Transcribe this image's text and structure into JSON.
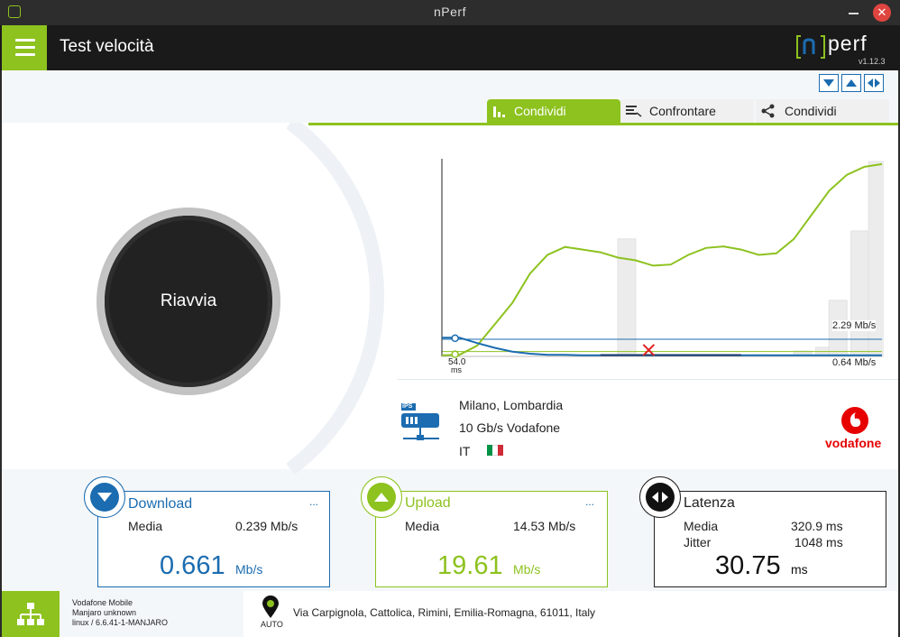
{
  "window": {
    "title": "nPerf"
  },
  "header": {
    "title": "Test velocità",
    "logo_text": "perf",
    "version": "v1.12.3"
  },
  "tabs": [
    {
      "label": "Condividi",
      "active": true,
      "icon": "bar-chart-icon"
    },
    {
      "label": "Confrontare",
      "active": false,
      "icon": "compare-icon"
    },
    {
      "label": "Condividi",
      "active": false,
      "icon": "share-icon"
    }
  ],
  "restart_button": {
    "label": "Riavvia"
  },
  "chart_data": {
    "type": "line",
    "x": [
      0,
      4,
      8,
      12,
      16,
      20,
      24,
      28,
      32,
      36,
      40,
      44,
      48,
      52,
      56,
      60,
      64,
      68,
      72,
      76,
      80,
      84,
      88,
      92,
      96,
      100
    ],
    "series": [
      {
        "color": "#8dc21f",
        "values": [
          0.2,
          0.3,
          2.0,
          6.0,
          10.0,
          15.5,
          19.0,
          20.5,
          20.0,
          19.5,
          18.5,
          18.0,
          17.0,
          17.2,
          19.0,
          20.3,
          20.6,
          20.0,
          19.0,
          19.3,
          22.0,
          26.5,
          31.0,
          34.0,
          35.5,
          36.0
        ]
      },
      {
        "color": "#1b6cb0",
        "values": [
          3.5,
          3.5,
          2.5,
          1.6,
          0.9,
          0.5,
          0.3,
          0.3,
          0.2,
          0.2,
          0.2,
          0.2,
          0.2,
          0.2,
          0.2,
          0.2,
          0.2,
          0.2,
          0.2,
          0.2,
          0.2,
          0.2,
          0.2,
          0.2,
          0.2,
          0.2
        ]
      }
    ],
    "bars": [
      {
        "x": 42,
        "value": 22
      },
      {
        "x": 72,
        "value": 0.3
      },
      {
        "x": 82,
        "value": 1.0
      },
      {
        "x": 87,
        "value": 1.7
      },
      {
        "x": 90,
        "value": 10.5
      },
      {
        "x": 95,
        "value": 23.5
      },
      {
        "x": 99,
        "value": 36.5
      }
    ],
    "ylim": [
      0,
      37
    ],
    "xlim": [
      0,
      100
    ],
    "labels": {
      "upload_avg": "2.29 Mb/s",
      "download_avg": "0.64 Mb/s",
      "latency_start": "54.0",
      "latency_unit": "ms"
    }
  },
  "server": {
    "location": "Milano, Lombardia",
    "capacity": "10 Gb/s Vodafone",
    "country": "IT",
    "ips_label": "IPS",
    "isp_name": "vodafone"
  },
  "download": {
    "title": "Download",
    "more": "...",
    "avg_label": "Media",
    "avg_value": "0.239 Mb/s",
    "value": "0.661",
    "unit": "Mb/s"
  },
  "upload": {
    "title": "Upload",
    "more": "...",
    "avg_label": "Media",
    "avg_value": "14.53 Mb/s",
    "value": "19.61",
    "unit": "Mb/s"
  },
  "latency": {
    "title": "Latenza",
    "avg_label": "Media",
    "avg_value": "320.9 ms",
    "jitter_label": "Jitter",
    "jitter_value": "1048 ms",
    "value": "30.75",
    "unit": "ms"
  },
  "footer": {
    "network_line1": "Vodafone Mobile",
    "network_line2": "Manjaro unknown",
    "network_line3": "linux / 6.6.41-1-MANJARO",
    "location_mode": "AUTO",
    "address": "Via Carpignola, Cattolica, Rimini, Emilia-Romagna, 61011, Italy"
  },
  "colors": {
    "accent_green": "#8dc21f",
    "accent_blue": "#1b6cb0",
    "vodafone_red": "#e60000",
    "error_red": "#e02020"
  }
}
